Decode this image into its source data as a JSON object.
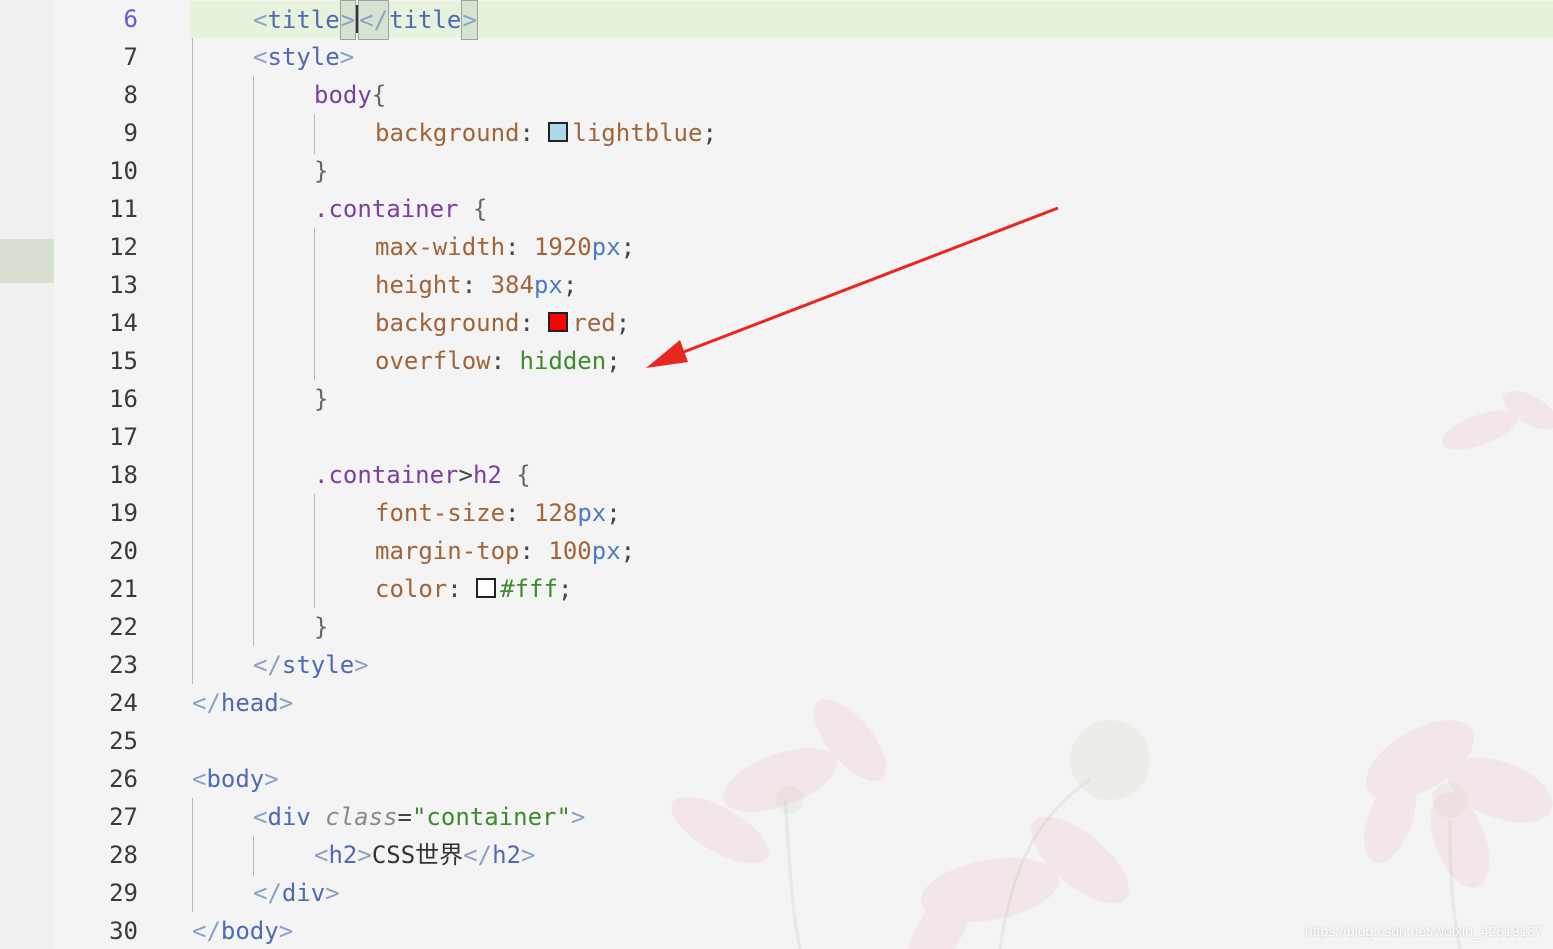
{
  "colors": {
    "swatch_lightblue": "#add8e6",
    "swatch_red": "#ff0000",
    "swatch_white": "#ffffff",
    "arrow": "#e8281e"
  },
  "lines": [
    {
      "num": "6",
      "cur": true
    },
    {
      "num": "7"
    },
    {
      "num": "8"
    },
    {
      "num": "9"
    },
    {
      "num": "10"
    },
    {
      "num": "11"
    },
    {
      "num": "12"
    },
    {
      "num": "13"
    },
    {
      "num": "14"
    },
    {
      "num": "15"
    },
    {
      "num": "16"
    },
    {
      "num": "17"
    },
    {
      "num": "18"
    },
    {
      "num": "19"
    },
    {
      "num": "20"
    },
    {
      "num": "21"
    },
    {
      "num": "22"
    },
    {
      "num": "23"
    },
    {
      "num": "24"
    },
    {
      "num": "25"
    },
    {
      "num": "26"
    },
    {
      "num": "27"
    },
    {
      "num": "28"
    },
    {
      "num": "29"
    },
    {
      "num": "30"
    }
  ],
  "code": {
    "l6": {
      "open_lt": "<",
      "open_tag": "title",
      "open_gt": ">",
      "close_lt": "</",
      "close_tag": "title",
      "close_gt": ">"
    },
    "l7": {
      "lt": "<",
      "tag": "style",
      "gt": ">"
    },
    "l8": {
      "sel": "body",
      "brace": "{"
    },
    "l9": {
      "prop": "background",
      "colon": ": ",
      "value": "lightblue",
      "semi": ";"
    },
    "l10": {
      "brace": "}"
    },
    "l11": {
      "sel": ".container",
      "brace": " {"
    },
    "l12": {
      "prop": "max-width",
      "colon": ": ",
      "num": "1920",
      "unit": "px",
      "semi": ";"
    },
    "l13": {
      "prop": "height",
      "colon": ": ",
      "num": "384",
      "unit": "px",
      "semi": ";"
    },
    "l14": {
      "prop": "background",
      "colon": ": ",
      "value": "red",
      "semi": ";"
    },
    "l15": {
      "prop": "overflow",
      "colon": ": ",
      "value": "hidden",
      "semi": ";"
    },
    "l16": {
      "brace": "}"
    },
    "l18": {
      "sel": ".container",
      "comb": ">",
      "tag": "h2",
      "brace": " {"
    },
    "l19": {
      "prop": "font-size",
      "colon": ": ",
      "num": "128",
      "unit": "px",
      "semi": ";"
    },
    "l20": {
      "prop": "margin-top",
      "colon": ": ",
      "num": "100",
      "unit": "px",
      "semi": ";"
    },
    "l21": {
      "prop": "color",
      "colon": ": ",
      "value": "#fff",
      "semi": ";"
    },
    "l22": {
      "brace": "}"
    },
    "l23": {
      "lt": "</",
      "tag": "style",
      "gt": ">"
    },
    "l24": {
      "lt": "</",
      "tag": "head",
      "gt": ">"
    },
    "l26": {
      "lt": "<",
      "tag": "body",
      "gt": ">"
    },
    "l27": {
      "lt": "<",
      "tag": "div",
      "attr": "class",
      "eq": "=",
      "str": "\"container\"",
      "gt": ">"
    },
    "l28": {
      "open_lt": "<",
      "open_tag": "h2",
      "open_gt": ">",
      "text": "CSS世界",
      "close_lt": "</",
      "close_tag": "h2",
      "close_gt": ">"
    },
    "l29": {
      "lt": "</",
      "tag": "div",
      "gt": ">"
    },
    "l30": {
      "lt": "</",
      "tag": "body",
      "gt": ">"
    }
  },
  "watermark": "https://blog.csdn.net/weixin_42519137"
}
